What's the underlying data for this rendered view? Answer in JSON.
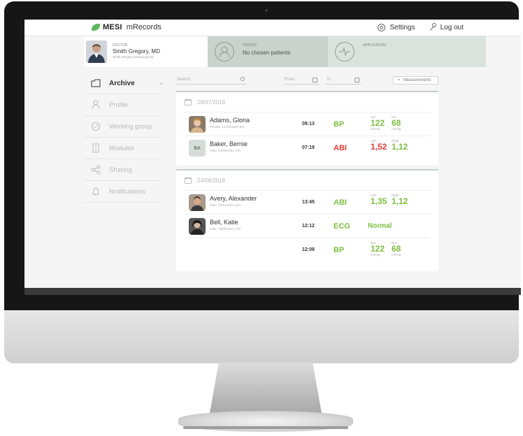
{
  "brand": {
    "name": "MESI",
    "subtitle": "mRecords"
  },
  "topbar": {
    "settings_label": "Settings",
    "logout_label": "Log out"
  },
  "doctor": {
    "label": "DOCTOR",
    "name": "Smith Gregory, MD",
    "group": "Smith Gregory working group"
  },
  "patient": {
    "label": "PATIENT",
    "value": "No chosen patients"
  },
  "application": {
    "label": "APPLICATION"
  },
  "sidebar": {
    "items": [
      {
        "label": "Archive",
        "icon": "archive-icon",
        "active": true
      },
      {
        "label": "Profile",
        "icon": "person-icon"
      },
      {
        "label": "Working group",
        "icon": "link-icon"
      },
      {
        "label": "Modules",
        "icon": "device-icon"
      },
      {
        "label": "Sharing",
        "icon": "share-icon"
      },
      {
        "label": "Notifications",
        "icon": "bell-icon"
      }
    ]
  },
  "filters": {
    "search_placeholder": "Search",
    "from_placeholder": "From",
    "to_placeholder": "To",
    "measurements_label": "Measurements"
  },
  "groups": [
    {
      "date": "18/07/2016",
      "records": [
        {
          "name": "Adams, Gloria",
          "sub": "Female, 12/03/1958 (59)",
          "time": "09:13",
          "type": "BP",
          "color": "green",
          "values": [
            {
              "label": "Sys",
              "value": "122",
              "unit": "mmHg"
            },
            {
              "label": "Dia",
              "value": "68",
              "unit": "mmHg"
            }
          ]
        },
        {
          "name": "Baker, Bernie",
          "initials": "BA",
          "sub": "Male, 03/09/1941 (76)",
          "time": "07:19",
          "type": "ABI",
          "color": "red",
          "values": [
            {
              "label": "Left",
              "value": "1,52",
              "color": "red"
            },
            {
              "label": "Right",
              "value": "1,12",
              "color": "green"
            }
          ]
        }
      ]
    },
    {
      "date": "24/06/2016",
      "records": [
        {
          "name": "Avery, Alexander",
          "sub": "Male, 22/01/1974 (43)",
          "time": "13:45",
          "type": "ABI",
          "color": "green",
          "values": [
            {
              "label": "Left",
              "value": "1,35"
            },
            {
              "label": "Right",
              "value": "1,12"
            }
          ]
        },
        {
          "name": "Bell, Katie",
          "sub": "Male, 28/09/1941 (76)",
          "time": "12:12",
          "type": "ECG",
          "color": "green",
          "result": "Normal"
        },
        {
          "time": "12:08",
          "type": "BP",
          "color": "green",
          "values": [
            {
              "label": "Sys",
              "value": "122",
              "unit": "mmHg"
            },
            {
              "label": "Dia",
              "value": "68",
              "unit": "mmHg"
            }
          ]
        }
      ]
    }
  ]
}
